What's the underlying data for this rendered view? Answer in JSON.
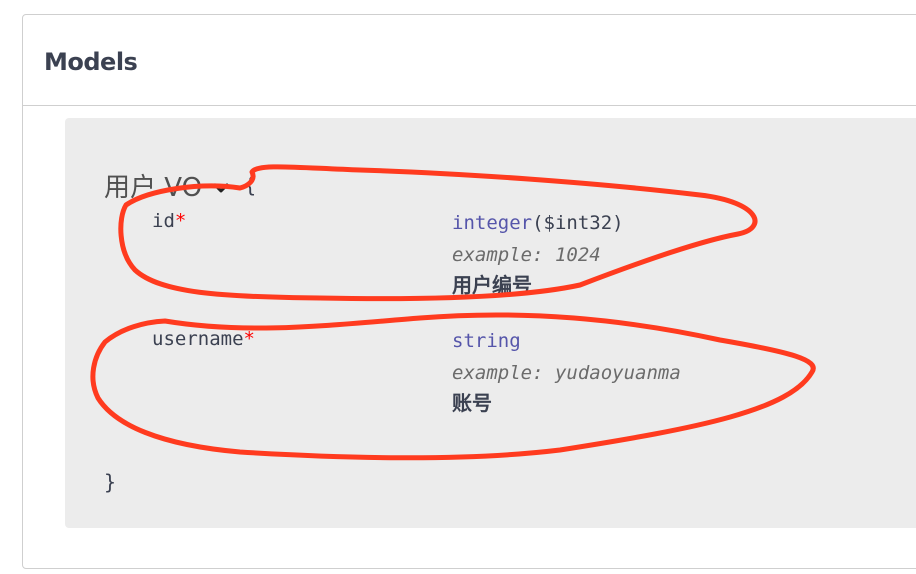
{
  "models": {
    "title": "Models"
  },
  "model": {
    "title": "用户 VO",
    "toggle_icon": "chevron-down-icon",
    "brace_open": "{",
    "brace_close": "}",
    "properties": [
      {
        "name": "id",
        "required_mark": "*",
        "type": "integer",
        "format": "($int32)",
        "example": "example: 1024",
        "description": "用户编号"
      },
      {
        "name": "username",
        "required_mark": "*",
        "type": "string",
        "format": "",
        "example": "example: yudaoyuanma",
        "description": "账号"
      }
    ]
  },
  "colors": {
    "required": "#ff0000",
    "type": "#5555aa",
    "annotation": "#ff3b1f",
    "panel_bg": "#ececec"
  }
}
